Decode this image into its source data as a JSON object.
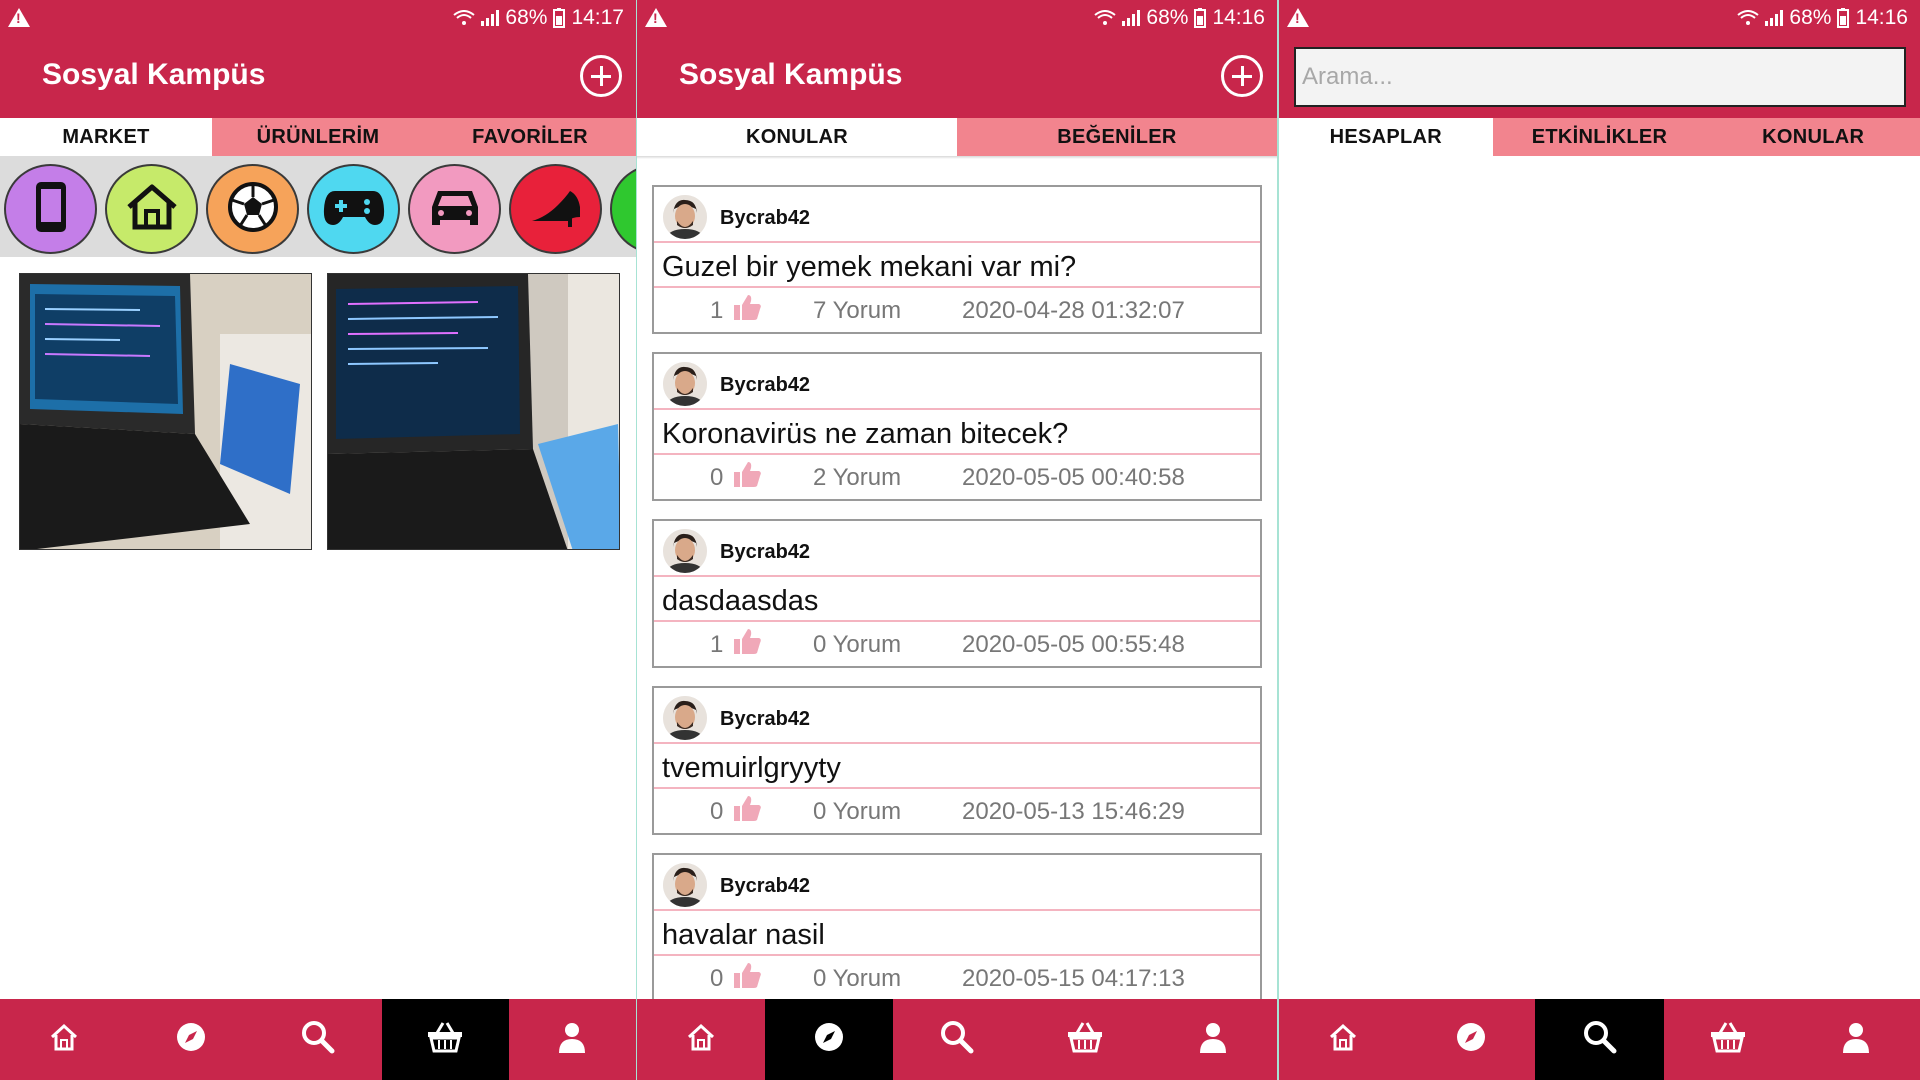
{
  "status_bar": {
    "battery": "68%",
    "times": [
      "14:17",
      "14:16",
      "14:16"
    ]
  },
  "app": {
    "title": "Sosyal Kampüs"
  },
  "market": {
    "tabs": [
      "MARKET",
      "ÜRÜNLERİM",
      "FAVORİLER"
    ],
    "active_tab": "MARKET",
    "categories": [
      {
        "icon": "phone-icon",
        "color": "#c47ee8"
      },
      {
        "icon": "home-icon",
        "color": "#c6ea6a"
      },
      {
        "icon": "football-icon",
        "color": "#f6a35a"
      },
      {
        "icon": "gamepad-icon",
        "color": "#4fd8f0"
      },
      {
        "icon": "car-icon",
        "color": "#f29ac0"
      },
      {
        "icon": "high-heel-icon",
        "color": "#e8213a"
      },
      {
        "icon": "more-category-icon",
        "color": "#2fc82f"
      }
    ]
  },
  "topics": {
    "tabs": [
      "KONULAR",
      "BEĞENİLER"
    ],
    "active_tab": "KONULAR",
    "posts": [
      {
        "author": "Bycrab42",
        "question": "Guzel bir yemek mekani var mi?",
        "likes": "1",
        "comments": "7 Yorum",
        "date": "2020-04-28 01:32:07"
      },
      {
        "author": "Bycrab42",
        "question": "Koronavirüs ne zaman bitecek?",
        "likes": "0",
        "comments": "2 Yorum",
        "date": "2020-05-05 00:40:58"
      },
      {
        "author": "Bycrab42",
        "question": "dasdaasdas",
        "likes": "1",
        "comments": "0 Yorum",
        "date": "2020-05-05 00:55:48"
      },
      {
        "author": "Bycrab42",
        "question": "tvemuirlgryyty",
        "likes": "0",
        "comments": "0 Yorum",
        "date": "2020-05-13 15:46:29"
      },
      {
        "author": "Bycrab42",
        "question": "havalar nasil",
        "likes": "0",
        "comments": "0 Yorum",
        "date": "2020-05-15 04:17:13"
      }
    ]
  },
  "search": {
    "placeholder": "Arama...",
    "tabs": [
      "HESAPLAR",
      "ETKİNLİKLER",
      "KONULAR"
    ],
    "active_tab": "HESAPLAR"
  },
  "bottom_nav": {
    "items": [
      "home-icon",
      "compass-icon",
      "search-icon",
      "basket-icon",
      "profile-icon"
    ],
    "active_per_panel": [
      "basket-icon",
      "compass-icon",
      "search-icon"
    ]
  },
  "colors": {
    "primary": "#c8264b",
    "tab_inactive": "#f2848e",
    "divider": "#f4b4c0",
    "thumb": "#f0a8b8"
  }
}
